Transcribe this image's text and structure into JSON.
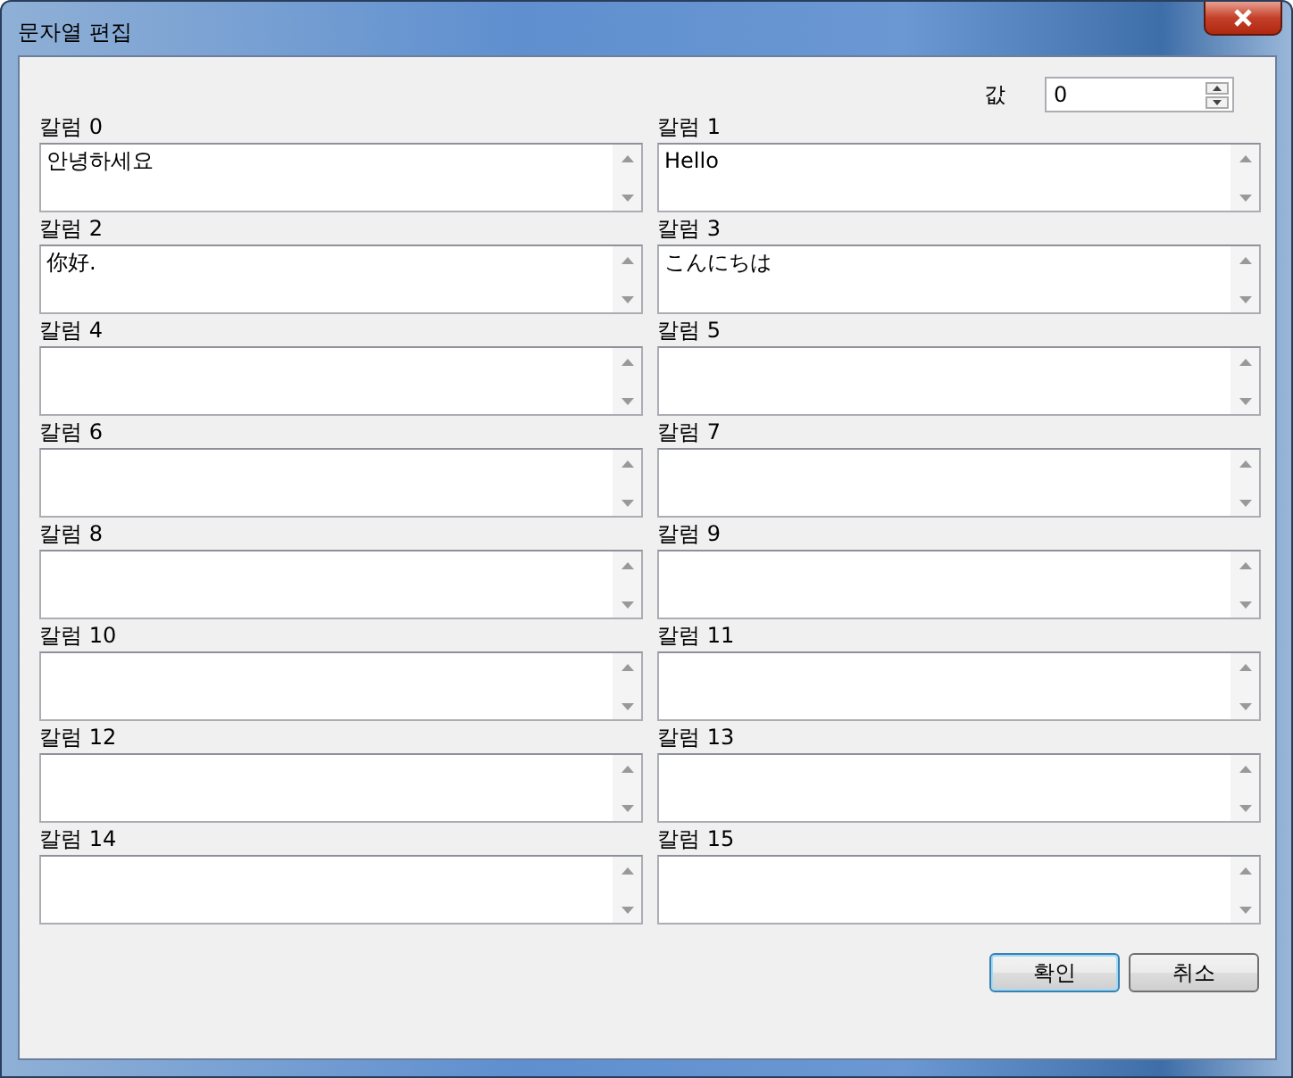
{
  "window": {
    "title": "문자열 편집"
  },
  "value_field": {
    "label": "값",
    "value": "0"
  },
  "columns": [
    {
      "label": "칼럼 0",
      "value": "안녕하세요"
    },
    {
      "label": "칼럼 1",
      "value": "Hello"
    },
    {
      "label": "칼럼 2",
      "value": "你好."
    },
    {
      "label": "칼럼 3",
      "value": "こんにちは"
    },
    {
      "label": "칼럼 4"
    },
    {
      "label": "칼럼 5"
    },
    {
      "label": "칼럼 6"
    },
    {
      "label": "칼럼 7"
    },
    {
      "label": "칼럼 8"
    },
    {
      "label": "칼럼 9"
    },
    {
      "label": "칼럼 10"
    },
    {
      "label": "칼럼 11"
    },
    {
      "label": "칼럼 12"
    },
    {
      "label": "칼럼 13"
    },
    {
      "label": "칼럼 14"
    },
    {
      "label": "칼럼 15"
    }
  ],
  "buttons": [
    {
      "label": "확인",
      "default": true
    },
    {
      "label": "취소",
      "default": false
    }
  ]
}
